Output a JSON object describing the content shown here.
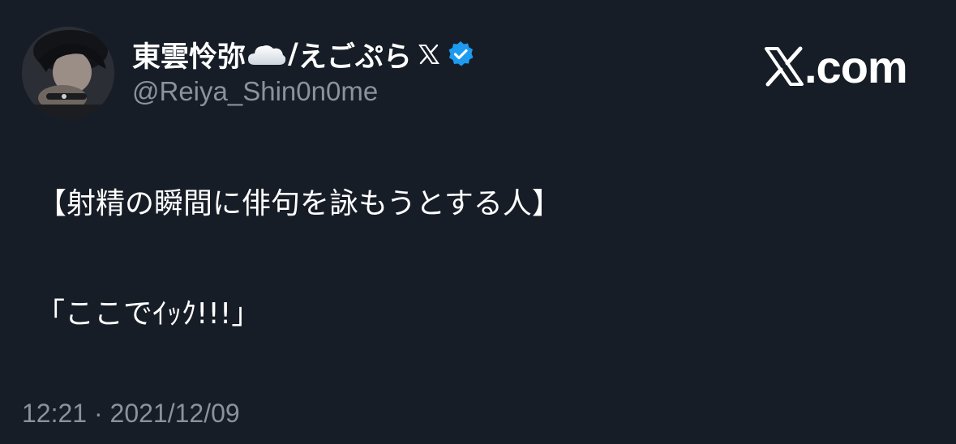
{
  "user": {
    "display_name_main": "東雲怜弥",
    "display_name_sep": "/",
    "display_name_suffix": "えごぷら",
    "handle": "@Reiya_Shin0n0me",
    "icons": [
      "avatar-photo",
      "cloud-emoji",
      "x-badge-icon",
      "verified-badge-icon"
    ]
  },
  "brand": {
    "logo_text": ".com",
    "logo_icon": "x-logo-icon"
  },
  "tweet": {
    "line1": "【射精の瞬間に俳句を詠もうとする人】",
    "line2": "「ここでｲｯｸ!!!」"
  },
  "meta": {
    "timestamp": "12:21 · 2021/12/09"
  },
  "colors": {
    "background": "#171d27",
    "primary_text": "#ffffff",
    "secondary_text": "#8b929c",
    "verified_blue": "#1d9bf0"
  }
}
